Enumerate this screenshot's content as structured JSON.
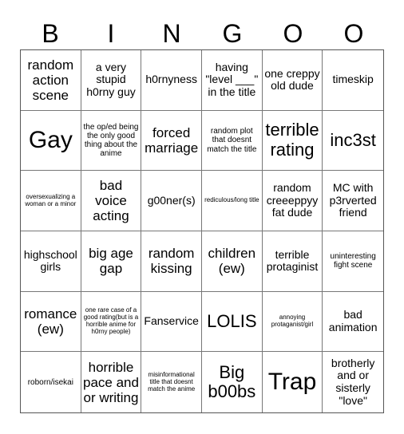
{
  "header": [
    "B",
    "I",
    "N",
    "G",
    "O",
    "O"
  ],
  "cells": [
    {
      "text": "random action scene",
      "size": "l"
    },
    {
      "text": "a very stupid h0rny guy",
      "size": "m"
    },
    {
      "text": "h0rnyness",
      "size": "m"
    },
    {
      "text": "having \"level ___\" in the title",
      "size": "m"
    },
    {
      "text": "one creppy old dude",
      "size": "m"
    },
    {
      "text": "timeskip",
      "size": "m"
    },
    {
      "text": "Gay",
      "size": "xxl"
    },
    {
      "text": "the op/ed being the only good thing about the anime",
      "size": "s"
    },
    {
      "text": "forced marriage",
      "size": "l"
    },
    {
      "text": "random plot that doesnt match the title",
      "size": "s"
    },
    {
      "text": "terrible rating",
      "size": "xl"
    },
    {
      "text": "inc3st",
      "size": "xl"
    },
    {
      "text": "oversexualizing a woman or a minor",
      "size": "xs"
    },
    {
      "text": "bad voice acting",
      "size": "l"
    },
    {
      "text": "g00ner(s)",
      "size": "m"
    },
    {
      "text": "rediculous/long title",
      "size": "xs"
    },
    {
      "text": "random creeeppyy fat dude",
      "size": "m"
    },
    {
      "text": "MC with p3rverted friend",
      "size": "m"
    },
    {
      "text": "highschool girls",
      "size": "m"
    },
    {
      "text": "big age gap",
      "size": "l"
    },
    {
      "text": "random kissing",
      "size": "l"
    },
    {
      "text": "children (ew)",
      "size": "l"
    },
    {
      "text": "terrible protaginist",
      "size": "m"
    },
    {
      "text": "uninteresting fight scene",
      "size": "s"
    },
    {
      "text": "romance (ew)",
      "size": "l"
    },
    {
      "text": "one rare case of a good rating(but is a horrible anime for h0rny people)",
      "size": "xs"
    },
    {
      "text": "Fanservice",
      "size": "m"
    },
    {
      "text": "LOLIS",
      "size": "xl"
    },
    {
      "text": "annoying protaganist/girl",
      "size": "xs"
    },
    {
      "text": "bad animation",
      "size": "m"
    },
    {
      "text": "roborn/isekai",
      "size": "s"
    },
    {
      "text": "horrible pace and or writing",
      "size": "l"
    },
    {
      "text": "misinformational title that doesnt match the anime",
      "size": "xs"
    },
    {
      "text": "Big b00bs",
      "size": "xl"
    },
    {
      "text": "Trap",
      "size": "xxl"
    },
    {
      "text": "brotherly and or sisterly \"love\"",
      "size": "m"
    }
  ]
}
